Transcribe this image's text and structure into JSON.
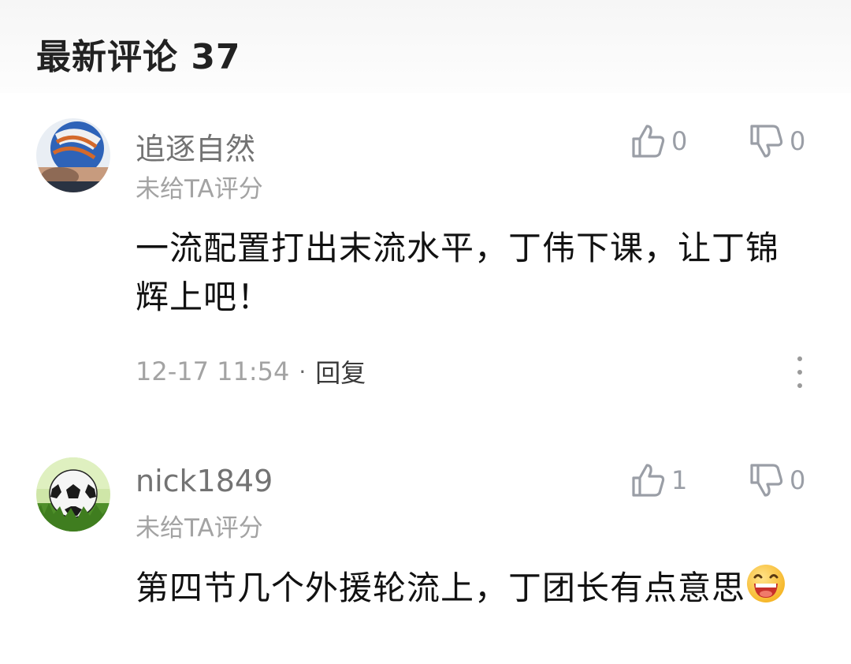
{
  "section": {
    "title": "最新评论 37"
  },
  "comments": [
    {
      "username": "追逐自然",
      "rating_text": "未给TA评分",
      "likes": "0",
      "dislikes": "0",
      "content": "一流配置打出末流水平，丁伟下课，让丁锦辉上吧！",
      "time": "12-17 11:54",
      "separator": "·",
      "reply_label": "回复"
    },
    {
      "username": "nick1849",
      "rating_text": "未给TA评分",
      "likes": "1",
      "dislikes": "0",
      "content": "第四节几个外援轮流上，丁团长有点意思",
      "emoji": "laughing-emoji"
    }
  ],
  "icons": {
    "like": "thumbs-up-icon",
    "dislike": "thumbs-down-icon",
    "more": "more-vertical-icon"
  },
  "colors": {
    "text_primary": "#111111",
    "text_secondary": "#a3a3a3",
    "icon": "#9a9ea6"
  }
}
